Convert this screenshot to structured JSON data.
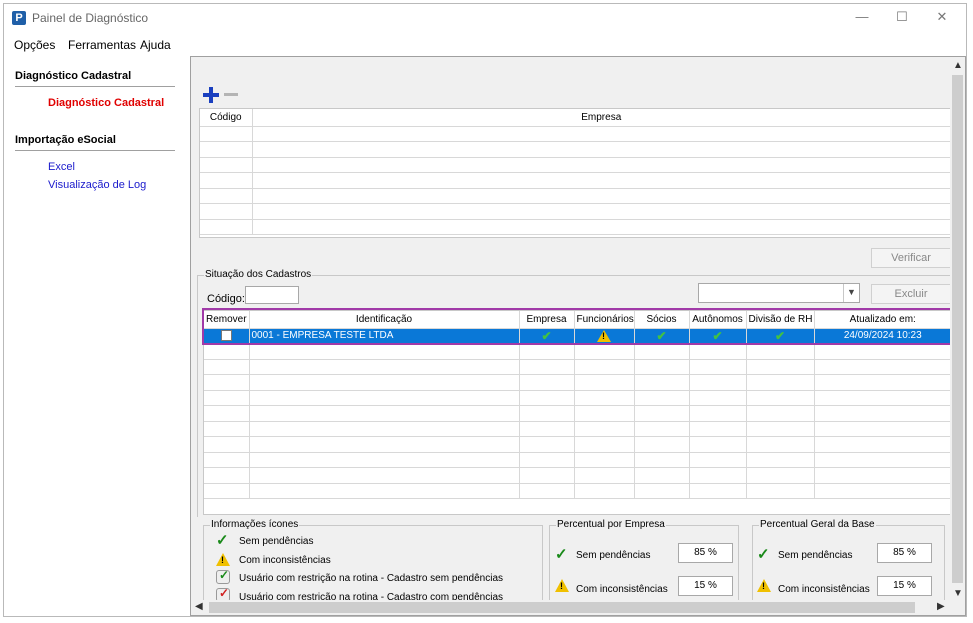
{
  "window": {
    "title": "Painel de Diagnóstico",
    "app_icon": "P",
    "controls": {
      "minimize": "—",
      "maximize": "☐",
      "close": "✕"
    }
  },
  "menu": [
    {
      "label": "Opções"
    },
    {
      "label": "Ferramentas"
    },
    {
      "label": "Ajuda"
    }
  ],
  "sidebar": {
    "sections": [
      {
        "title": "Diagnóstico Cadastral",
        "items": [
          {
            "label": "Diagnóstico Cadastral",
            "active": true
          }
        ]
      },
      {
        "title": "Importação eSocial",
        "items": [
          {
            "label": "Excel"
          },
          {
            "label": "Visualização de Log"
          }
        ]
      }
    ]
  },
  "top_grid": {
    "columns": [
      "Código",
      "Empresa"
    ]
  },
  "buttons": {
    "verificar": "Verificar",
    "excluir": "Excluir"
  },
  "situacao": {
    "title": "Situação dos Cadastros",
    "codigo_label": "Código:",
    "codigo_value": "",
    "filter_value": "",
    "columns": [
      "Remover",
      "Identificação",
      "Empresa",
      "Funcionários",
      "Sócios",
      "Autônomos",
      "Divisão de RH",
      "Atualizado em:"
    ],
    "rows": [
      {
        "identificacao": "0001 - EMPRESA TESTE LTDA",
        "empresa": "ok",
        "funcionarios": "warning",
        "socios": "ok",
        "autonomos": "ok",
        "divisao_rh": "ok",
        "atualizado": "24/09/2024 10:23",
        "selected": true
      }
    ]
  },
  "legend": {
    "title": "Informações ícones",
    "items": [
      {
        "icon": "check-icon",
        "label": "Sem pendências"
      },
      {
        "icon": "warning-icon",
        "label": "Com inconsistências"
      },
      {
        "icon": "user-restriction-ok-icon",
        "label": "Usuário com restrição na rotina - Cadastro sem pendências"
      },
      {
        "icon": "user-restriction-error-icon",
        "label": "Usuário com restrição na rotina - Cadastro com pendências"
      }
    ]
  },
  "percent_empresa": {
    "title": "Percentual por Empresa",
    "sem_label": "Sem pendências",
    "sem_value": "85 %",
    "com_label": "Com inconsistências",
    "com_value": "15 %"
  },
  "percent_base": {
    "title": "Percentual Geral da Base",
    "sem_label": "Sem pendências",
    "sem_value": "85 %",
    "com_label": "Com inconsistências",
    "com_value": "15 %"
  },
  "colors": {
    "selection": "#0a78d7",
    "highlight": "#a13aa8",
    "active_link": "#e00000",
    "link": "#1a1acc"
  }
}
